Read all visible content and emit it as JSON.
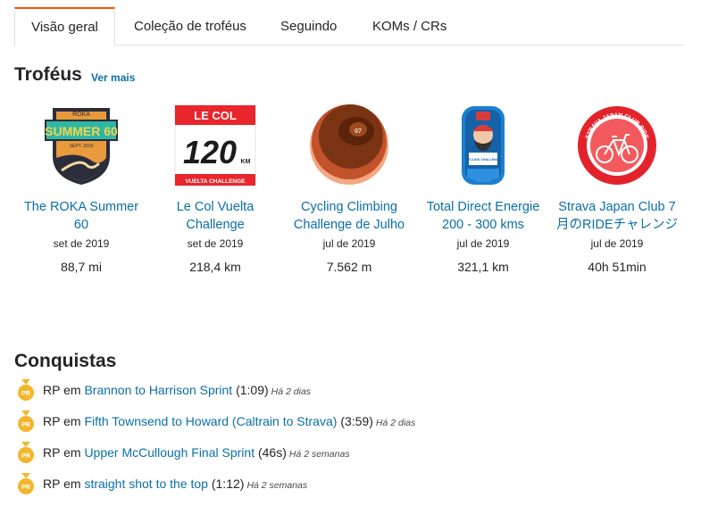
{
  "tabs": [
    {
      "label": "Visão geral",
      "active": true
    },
    {
      "label": "Coleção de troféus",
      "active": false
    },
    {
      "label": "Seguindo",
      "active": false
    },
    {
      "label": "KOMs / CRs",
      "active": false
    }
  ],
  "trophies": {
    "title": "Troféus",
    "see_more": "Ver mais",
    "items": [
      {
        "name": "The ROKA Summer 60",
        "date": "set de 2019",
        "value": "88,7 mi",
        "badge": {
          "brand": "RŌKA",
          "line1": "SUMMER 60",
          "line2": "SEPT. 2019"
        }
      },
      {
        "name": "Le Col Vuelta Challenge",
        "date": "set de 2019",
        "value": "218,4 km",
        "badge": {
          "brand": "LE COL",
          "number": "120",
          "unit": "KM",
          "footer": "VUELTA CHALLENGE"
        }
      },
      {
        "name": "Cycling Climbing Challenge de Julho",
        "date": "jul de 2019",
        "value": "7.562 m",
        "badge": {
          "number": "07"
        }
      },
      {
        "name": "Total Direct Energie 200 - 300 kms",
        "date": "jul de 2019",
        "value": "321,1 km",
        "badge": {
          "label": "CYCLING CHALLENGE"
        }
      },
      {
        "name": "Strava Japan Club 7月のRIDEチャレンジ",
        "date": "jul de 2019",
        "value": "40h 51min",
        "badge": {
          "ring": "STRAVA JAPAN CLUB RIDE"
        }
      }
    ]
  },
  "achievements": {
    "title": "Conquistas",
    "prefix": "RP em",
    "medal_label": "PR",
    "items": [
      {
        "segment": "Brannon to Harrison Sprint",
        "time": "(1:09)",
        "ago": "Há 2 dias"
      },
      {
        "segment": "Fifth Townsend to Howard (Caltrain to Strava)",
        "time": "(3:59)",
        "ago": "Há 2 dias"
      },
      {
        "segment": "Upper McCullough Final Sprint",
        "time": "(46s)",
        "ago": "Há 2 semanas"
      },
      {
        "segment": "straight shot to the top",
        "time": "(1:12)",
        "ago": "Há 2 semanas"
      }
    ]
  },
  "colors": {
    "accent": "#fc5200",
    "link": "#0a6fa8",
    "medal": "#f3b52c"
  }
}
